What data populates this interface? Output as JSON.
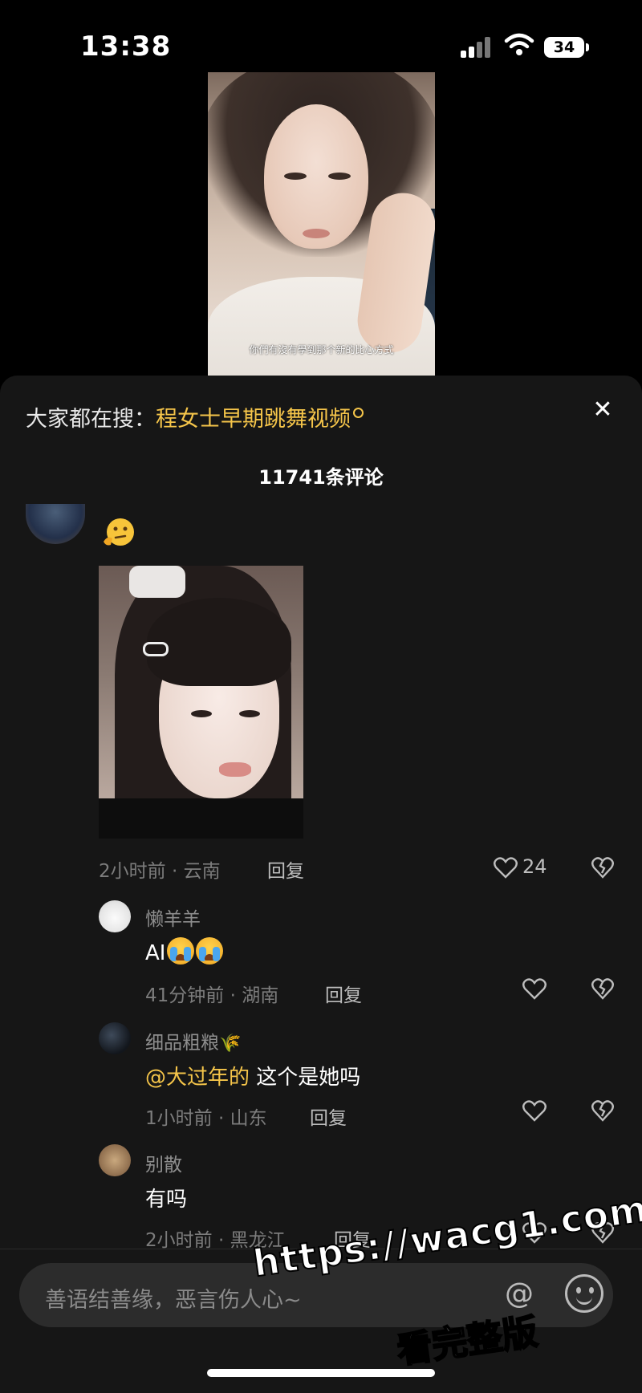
{
  "status_bar": {
    "time": "13:38",
    "battery": "34"
  },
  "video": {
    "caption": "你們有沒有學到那个新的比心方式"
  },
  "search_hint": {
    "prefix": "大家都在搜：",
    "query": "程女士早期跳舞视频"
  },
  "comments_header": {
    "count_label": "11741条评论"
  },
  "main_comment": {
    "time_location": "2小时前 · 云南",
    "reply_label": "回复",
    "likes": "24"
  },
  "replies": [
    {
      "username": "懒羊羊",
      "text": "AI",
      "time_location": "41分钟前 · 湖南",
      "reply_label": "回复"
    },
    {
      "username": "细品粗粮",
      "mention": "@大过年的",
      "text": " 这个是她吗",
      "time_location": "1小时前 · 山东",
      "reply_label": "回复"
    },
    {
      "username": "别散",
      "text": "有吗",
      "time_location": "2小时前 · 黑龙江",
      "reply_label": "回复"
    }
  ],
  "input": {
    "placeholder": "善语结善缘，恶言伤人心~"
  },
  "watermark": {
    "line1": "https://wacg1.com",
    "line2": "看完整版"
  },
  "icons": {
    "signal": "signal-icon",
    "wifi": "wifi-icon",
    "close": "close-icon",
    "heart": "heart-icon",
    "dislike": "broken-heart-icon",
    "at": "at-icon",
    "emoji": "emoji-icon"
  },
  "colors": {
    "accent": "#f5c54a",
    "panel": "#161616",
    "muted": "#7c7c7c"
  }
}
